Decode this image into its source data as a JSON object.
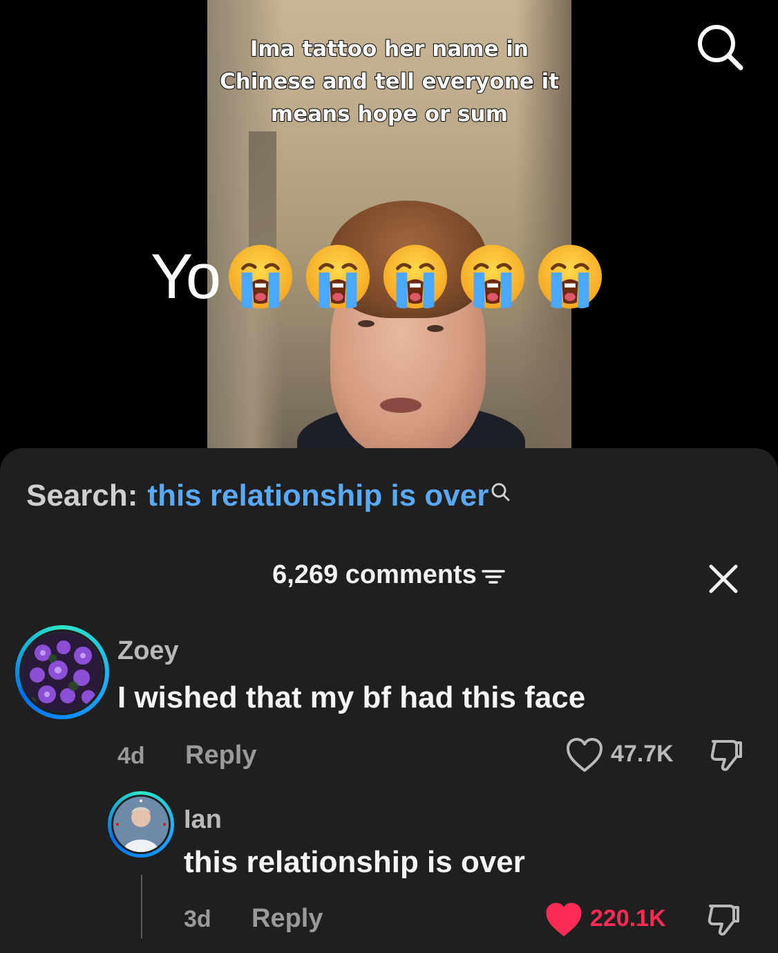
{
  "video": {
    "caption": "Ima tattoo her name in Chinese and tell everyone it means hope or sum",
    "overlay_text": "Yo",
    "overlay_emoji_icon": "loudly-crying-face-icon",
    "overlay_emoji_count": 5
  },
  "top_bar": {
    "search_icon": "search-icon"
  },
  "search_suggestion": {
    "prefix": "Search:",
    "query": "this relationship is over",
    "icon": "search-icon",
    "query_color": "#5aa9f5"
  },
  "comments_header": {
    "count_label": "6,269 comments",
    "sort_icon": "filter-icon",
    "close_icon": "close-icon"
  },
  "comments": [
    {
      "username": "Zoey",
      "text": "I wished that my bf had this face",
      "time": "4d",
      "reply_label": "Reply",
      "likes": "47.7K",
      "liked": false,
      "avatar": "purple-flowers"
    },
    {
      "username": "Ian",
      "text": "this relationship is over",
      "time": "3d",
      "reply_label": "Reply",
      "likes": "220.1K",
      "liked": true,
      "liked_color": "#fe2c55",
      "avatar": "selfie"
    }
  ]
}
